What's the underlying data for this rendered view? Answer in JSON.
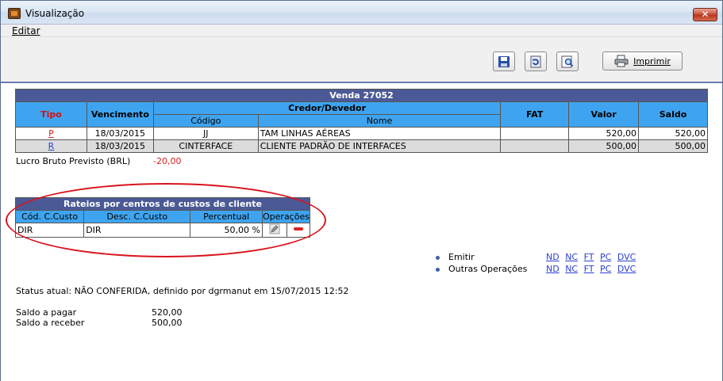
{
  "window": {
    "title": "Visualização",
    "close": "✕"
  },
  "menu": {
    "edit": "Editar"
  },
  "toolbar": {
    "print_label": "Imprimir"
  },
  "venda": {
    "caption": "Venda  27052",
    "headers": {
      "tipo": "Tipo",
      "vencimento": "Vencimento",
      "credor_devedor": "Credor/Devedor",
      "codigo": "Código",
      "nome": "Nome",
      "fat": "FAT",
      "valor": "Valor",
      "saldo": "Saldo"
    },
    "rows": [
      {
        "tipo": "P",
        "vencimento": "18/03/2015",
        "codigo": "JJ",
        "nome": "TAM LINHAS AÉREAS",
        "fat": "",
        "valor": "520,00",
        "saldo": "520,00"
      },
      {
        "tipo": "R",
        "vencimento": "18/03/2015",
        "codigo": "CINTERFACE",
        "nome": "CLIENTE PADRÃO DE INTERFACES",
        "fat": "",
        "valor": "500,00",
        "saldo": "500,00"
      }
    ]
  },
  "lucro": {
    "label": "Lucro Bruto Previsto (BRL)",
    "value": "-20,00"
  },
  "rateio": {
    "caption": "Rateios por centros de custos de cliente",
    "headers": {
      "cod": "Cód. C.Custo",
      "desc": "Desc. C.Custo",
      "percentual": "Percentual",
      "operacoes": "Operações"
    },
    "rows": [
      {
        "cod": "DIR",
        "desc": "DIR",
        "percentual": "50,00 %"
      }
    ]
  },
  "operations": {
    "emitir": "Emitir",
    "outras": "Outras Operações",
    "links": [
      "ND",
      "NC",
      "FT",
      "PC",
      "DVC"
    ]
  },
  "status": "Status atual: NÃO CONFERIDA, definido por dgrmanut em 15/07/2015 12:52",
  "saldos": {
    "pagar_label": "Saldo a pagar",
    "pagar_value": "520,00",
    "receber_label": "Saldo a receber",
    "receber_value": "500,00"
  },
  "colors": {
    "caption_bg": "#4b5a96",
    "header_bg": "#3fa4f0",
    "negative": "#e02020",
    "link": "#2a3fd0",
    "highlight_oval": "#d8141e"
  }
}
